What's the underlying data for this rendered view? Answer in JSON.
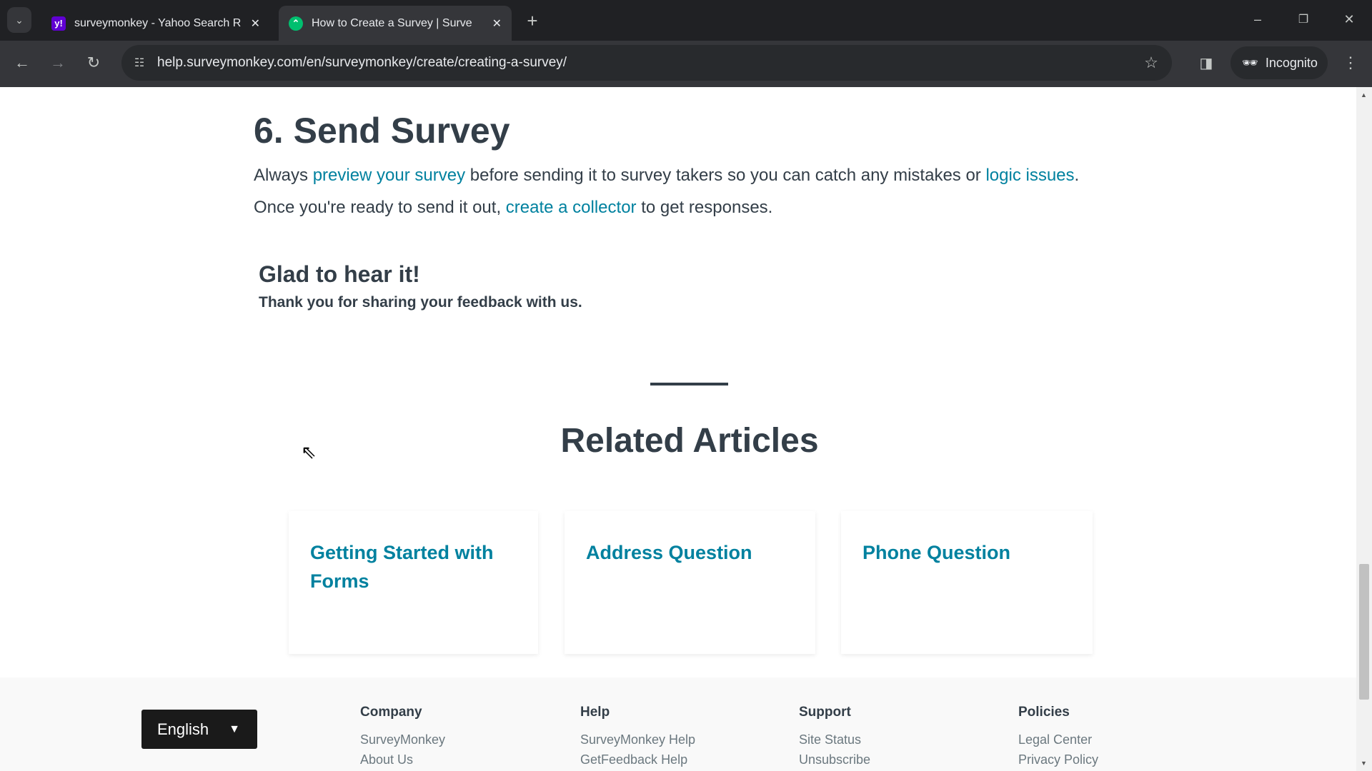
{
  "browser": {
    "tabs": [
      {
        "title": "surveymonkey - Yahoo Search R",
        "favicon": "yahoo-icon",
        "active": false
      },
      {
        "title": "How to Create a Survey | Surve",
        "favicon": "surveymonkey-icon",
        "active": true
      }
    ],
    "url": "help.surveymonkey.com/en/surveymonkey/create/creating-a-survey/",
    "profile": "Incognito"
  },
  "article": {
    "heading": "6. Send Survey",
    "p1": {
      "pre": "Always ",
      "link1": "preview your survey",
      "mid": " before sending it to survey takers so you can catch any mistakes or ",
      "link2": "logic issues",
      "post": "."
    },
    "p2": {
      "pre": "Once you're ready to send it out, ",
      "link": "create a collector",
      "post": " to get responses."
    },
    "feedback": {
      "title": "Glad to hear it!",
      "text": "Thank you for sharing your feedback with us."
    }
  },
  "related": {
    "title": "Related Articles",
    "items": [
      "Getting Started with Forms",
      "Address Question",
      "Phone Question"
    ]
  },
  "footer": {
    "language": "English",
    "columns": [
      {
        "heading": "Company",
        "links": [
          "SurveyMonkey",
          "About Us"
        ]
      },
      {
        "heading": "Help",
        "links": [
          "SurveyMonkey Help",
          "GetFeedback Help"
        ]
      },
      {
        "heading": "Support",
        "links": [
          "Site Status",
          "Unsubscribe"
        ]
      },
      {
        "heading": "Policies",
        "links": [
          "Legal Center",
          "Privacy Policy"
        ]
      }
    ]
  },
  "colors": {
    "link": "#00819f",
    "text": "#333e48",
    "brand_green": "#00bf6f"
  }
}
